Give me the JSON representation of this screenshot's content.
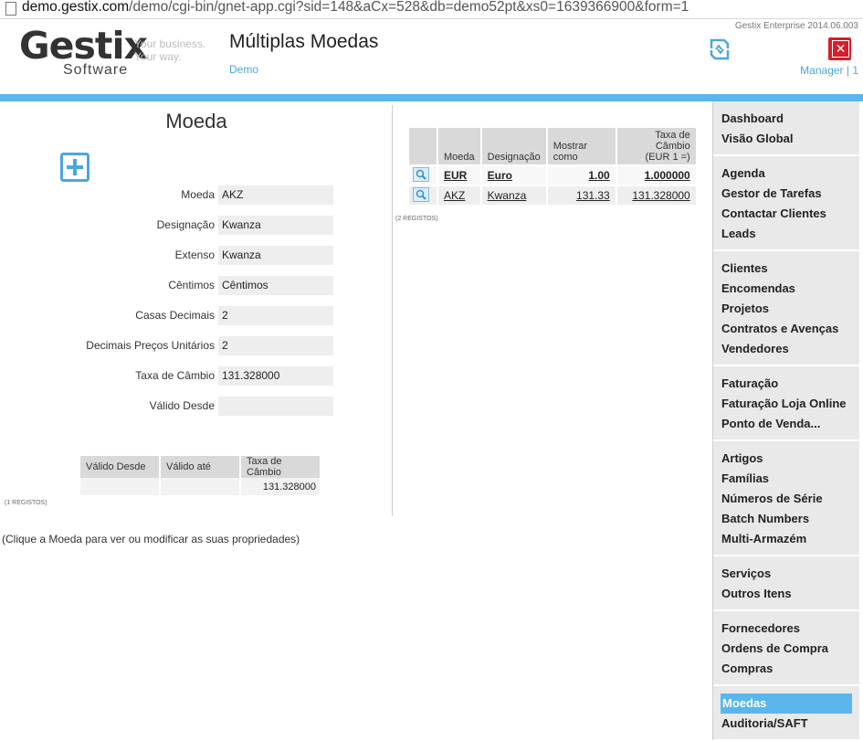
{
  "browser": {
    "url_domain": "demo.gestix.com",
    "url_rest": "/demo/cgi-bin/gnet-app.cgi?sid=148&aCx=528&db=demo52pt&xs0=1639366900&form=1"
  },
  "header": {
    "version": "Gestix Enterprise 2014.06.003",
    "logo_main": "Gestix",
    "logo_sub": "Software",
    "tagline1": "Your business.",
    "tagline2": "Your way.",
    "title": "Múltiplas Moedas",
    "subtitle": "Demo",
    "user": "Manager | 1"
  },
  "form": {
    "title": "Moeda",
    "fields": [
      {
        "label": "Moeda",
        "value": "AKZ"
      },
      {
        "label": "Designação",
        "value": "Kwanza"
      },
      {
        "label": "Extenso",
        "value": "Kwanza"
      },
      {
        "label": "Cêntimos",
        "value": "Cêntimos"
      },
      {
        "label": "Casas Decimais",
        "value": "2"
      },
      {
        "label": "Decimais Preços Unitários",
        "value": "2"
      },
      {
        "label": "Taxa de Câmbio",
        "value": "131.328000"
      },
      {
        "label": "Válido Desde",
        "value": ""
      }
    ]
  },
  "history": {
    "headers": [
      "Válido Desde",
      "Válido até",
      "Taxa de Câmbio"
    ],
    "rows": [
      [
        "",
        "",
        "131.328000"
      ]
    ],
    "count": "(1 REGISTOS)"
  },
  "hint": "(Clique a Moeda para ver ou modificar as suas propriedades)",
  "currencies": {
    "headers": {
      "moeda": "Moeda",
      "designacao": "Designação",
      "mostrar": "Mostrar como",
      "taxa1": "Taxa de Câmbio",
      "taxa2": "(EUR 1 =)"
    },
    "rows": [
      {
        "moeda": "EUR",
        "designacao": "Euro",
        "mostrar": "1.00",
        "taxa": "1.000000"
      },
      {
        "moeda": "AKZ",
        "designacao": "Kwanza",
        "mostrar": "131.33",
        "taxa": "131.328000"
      }
    ],
    "count": "(2 REGISTOS)"
  },
  "sidebar": [
    [
      "Dashboard",
      "Visão Global"
    ],
    [
      "Agenda",
      "Gestor de Tarefas",
      "Contactar Clientes",
      "Leads"
    ],
    [
      "Clientes",
      "Encomendas",
      "Projetos",
      "Contratos e Avenças",
      "Vendedores"
    ],
    [
      "Faturação",
      "Faturação Loja Online",
      "Ponto de Venda..."
    ],
    [
      "Artigos",
      "Famílias",
      "Números de Série",
      "Batch Numbers",
      "Multi-Armazém"
    ],
    [
      "Serviços",
      "Outros Itens"
    ],
    [
      "Fornecedores",
      "Ordens de Compra",
      "Compras"
    ],
    [
      "Moedas",
      "Auditoria/SAFT"
    ]
  ],
  "sidebar_active": "Moedas",
  "colors": {
    "accent": "#5bb6ec",
    "close": "#d61f2a"
  }
}
